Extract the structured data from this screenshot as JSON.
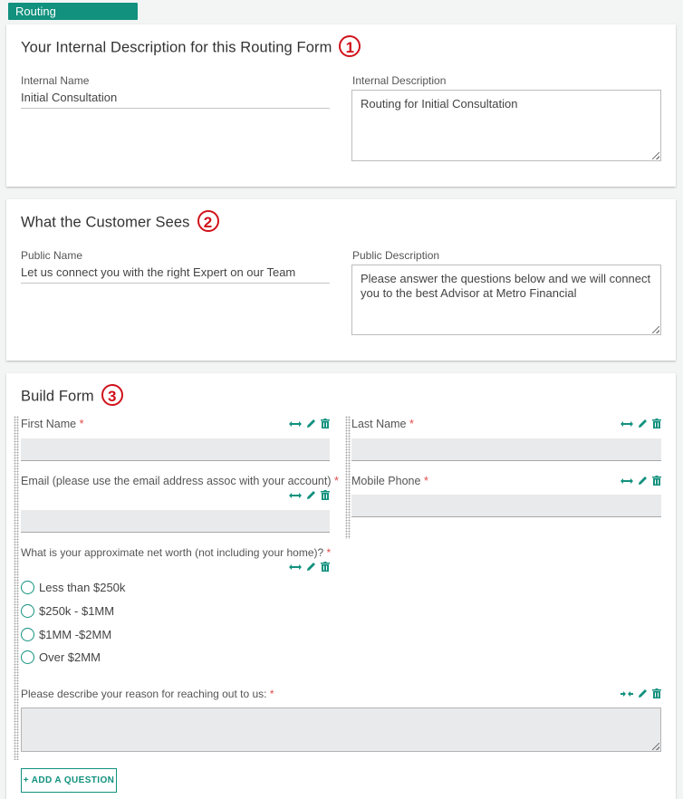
{
  "tab": {
    "label": "Routing"
  },
  "colors": {
    "accent": "#11917e",
    "badge": "#d0121b",
    "required": "#e04a4a"
  },
  "section1": {
    "title": "Your Internal Description for this Routing Form",
    "badge": "1",
    "internal_name_label": "Internal Name",
    "internal_name_value": "Initial Consultation",
    "internal_description_label": "Internal Description",
    "internal_description_value": "Routing for Initial Consultation"
  },
  "section2": {
    "title": "What the Customer Sees",
    "badge": "2",
    "public_name_label": "Public Name",
    "public_name_value": "Let us connect you with the right Expert on our Team",
    "public_description_label": "Public Description",
    "public_description_value": "Please answer the questions below and we will connect you to the best Advisor at Metro Financial"
  },
  "section3": {
    "title": "Build Form",
    "badge": "3",
    "required_marker": "*",
    "questions": [
      {
        "label": "First Name",
        "type": "text",
        "width_action": "expand"
      },
      {
        "label": "Last Name",
        "type": "text",
        "width_action": "expand"
      },
      {
        "label": "Email (please use the email address assoc with your account)",
        "type": "text",
        "width_action": "expand"
      },
      {
        "label": "Mobile Phone",
        "type": "text",
        "width_action": "expand"
      },
      {
        "label": "What is your approximate net worth (not including your home)?",
        "type": "radio",
        "width_action": "expand",
        "options": [
          "Less than $250k",
          "$250k - $1MM",
          "$1MM -$2MM",
          "Over $2MM"
        ]
      },
      {
        "label": "Please describe your reason for reaching out to us:",
        "type": "textarea",
        "width_action": "compress"
      }
    ],
    "add_button": "+ ADD A QUESTION"
  }
}
